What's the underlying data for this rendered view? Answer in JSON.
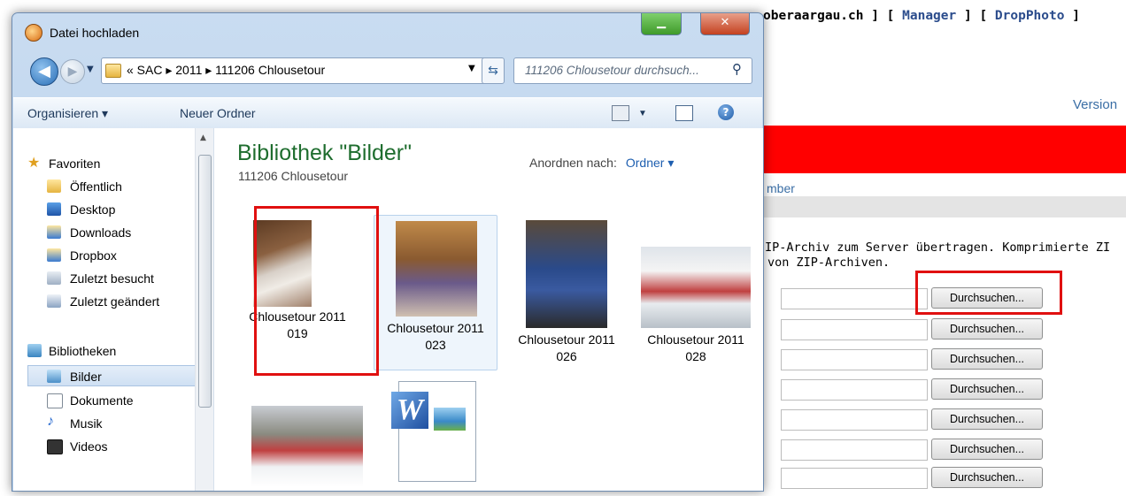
{
  "background_page": {
    "top_links_prefix": "oberaargau.ch ] [ ",
    "manager_link": "Manager",
    "links_mid": " ] [ ",
    "dropphoto_link": "DropPhoto",
    "links_suffix": " ]",
    "version_link": "Version",
    "member_link": "mber",
    "info_line1": "IP-Archiv zum Server übertragen. Komprimierte ZI",
    "info_line2": "von ZIP-Archiven.",
    "browse_label": "Durchsuchen...",
    "colors": {
      "red_bar": "#ff0000",
      "link": "#3a6ea5",
      "highlight_box": "#e01010"
    }
  },
  "dialog": {
    "title": "Datei hochladen",
    "address": {
      "crumbs": "«  SAC  ▸  2011  ▸  111206 Chlousetour"
    },
    "search_placeholder": "111206 Chlousetour durchsuch...",
    "toolbar": {
      "organize": "Organisieren ▾",
      "new_folder": "Neuer Ordner"
    },
    "nav": {
      "favorites": "Favoriten",
      "items": [
        "Öffentlich",
        "Desktop",
        "Downloads",
        "Dropbox",
        "Zuletzt besucht",
        "Zuletzt geändert"
      ],
      "libraries": "Bibliotheken",
      "lib_items": [
        "Bilder",
        "Dokumente",
        "Musik",
        "Videos"
      ]
    },
    "library": {
      "title": "Bibliothek \"Bilder\"",
      "subtitle": "111206 Chlousetour",
      "arrange_label": "Anordnen nach:",
      "arrange_value": "Ordner ▾"
    },
    "files": [
      {
        "line1": "Chlousetour 2011",
        "line2": "019"
      },
      {
        "line1": "Chlousetour 2011",
        "line2": "023"
      },
      {
        "line1": "Chlousetour 2011",
        "line2": "026"
      },
      {
        "line1": "Chlousetour 2011",
        "line2": "028"
      }
    ]
  }
}
